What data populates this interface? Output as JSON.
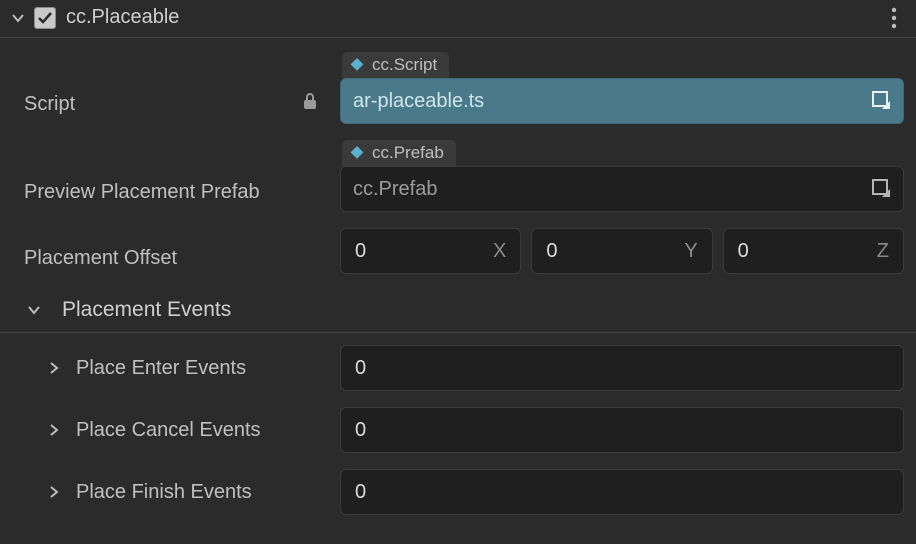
{
  "header": {
    "title": "cc.Placeable",
    "checked": true
  },
  "script": {
    "label": "Script",
    "chip": "cc.Script",
    "value": "ar-placeable.ts"
  },
  "prefab": {
    "label": "Preview Placement Prefab",
    "chip": "cc.Prefab",
    "placeholder": "cc.Prefab"
  },
  "offset": {
    "label": "Placement Offset",
    "x": "0",
    "y": "0",
    "z": "0",
    "xl": "X",
    "yl": "Y",
    "zl": "Z"
  },
  "events": {
    "sectionTitle": "Placement Events",
    "items": [
      {
        "label": "Place Enter Events",
        "count": "0"
      },
      {
        "label": "Place Cancel Events",
        "count": "0"
      },
      {
        "label": "Place Finish Events",
        "count": "0"
      }
    ]
  },
  "colors": {
    "diamond_script": "#57b2d1",
    "diamond_prefab": "#57b2d1"
  }
}
